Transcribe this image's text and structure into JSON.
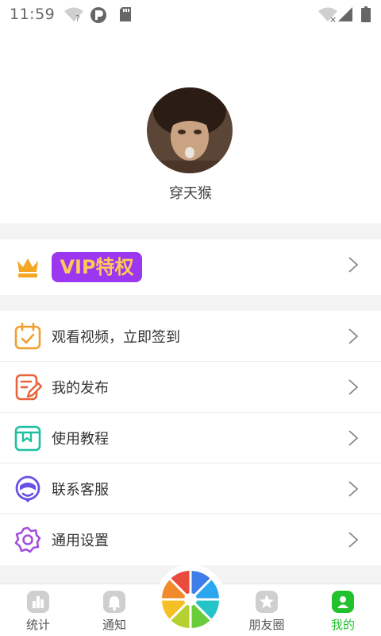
{
  "status_bar": {
    "time": "11:59"
  },
  "profile": {
    "username": "穿天猴"
  },
  "vip": {
    "label": "VIP特权"
  },
  "menu": {
    "items": [
      {
        "label": "观看视频，立即签到",
        "icon": "calendar-check-icon"
      },
      {
        "label": "我的发布",
        "icon": "note-edit-icon"
      },
      {
        "label": "使用教程",
        "icon": "book-icon"
      },
      {
        "label": "联系客服",
        "icon": "headset-icon"
      },
      {
        "label": "通用设置",
        "icon": "gear-icon"
      }
    ]
  },
  "tabbar": {
    "tabs": [
      {
        "label": "统计",
        "icon": "bar-chart-icon"
      },
      {
        "label": "通知",
        "icon": "bell-icon"
      },
      {
        "label": "朋友圈",
        "icon": "star-icon"
      },
      {
        "label": "我的",
        "icon": "user-icon"
      }
    ],
    "active": "我的"
  },
  "colors": {
    "accent": "#22c22e",
    "vip_purple": "#9b37f0",
    "vip_text": "#ffc85a",
    "crown": "#f5a623"
  }
}
